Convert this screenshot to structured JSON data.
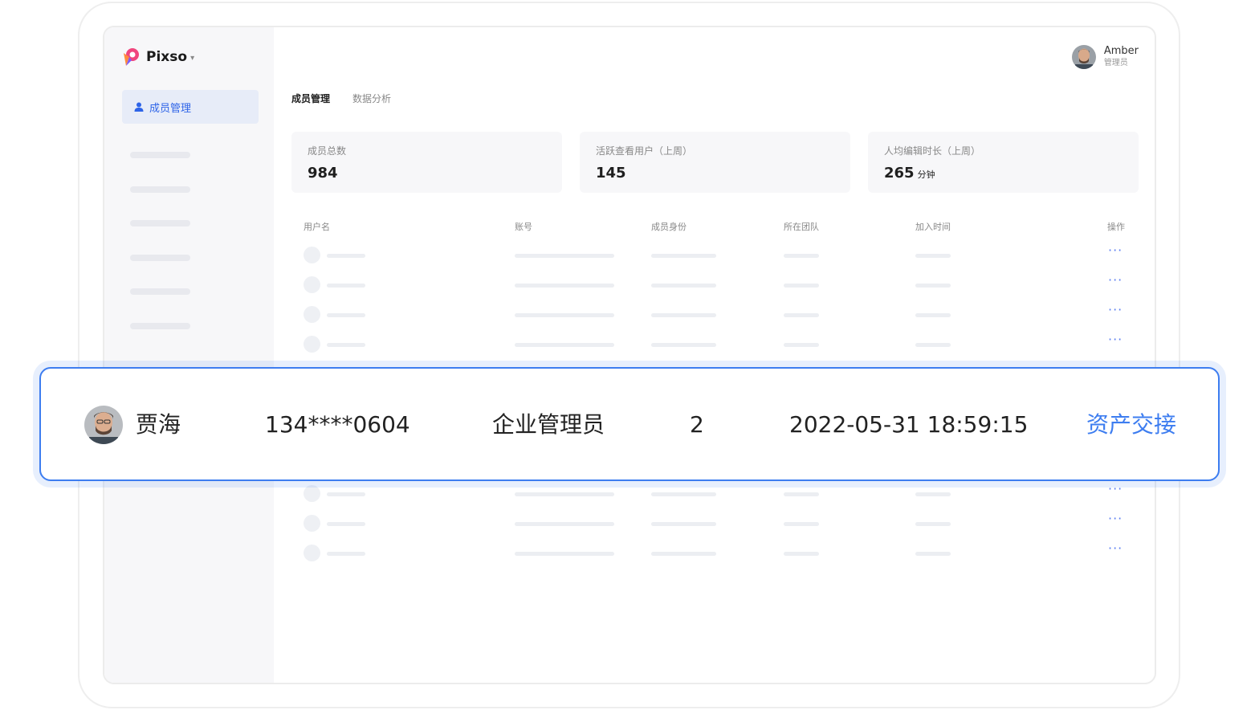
{
  "app": {
    "name": "Pixso"
  },
  "sidebar": {
    "items": [
      {
        "label": "成员管理"
      }
    ]
  },
  "user": {
    "name": "Amber",
    "role": "管理员"
  },
  "tabs": [
    {
      "label": "成员管理",
      "active": true
    },
    {
      "label": "数据分析",
      "active": false
    }
  ],
  "stats": [
    {
      "label": "成员总数",
      "value": "984",
      "unit": ""
    },
    {
      "label": "活跃查看用户（上周）",
      "value": "145",
      "unit": ""
    },
    {
      "label": "人均编辑时长（上周）",
      "value": "265",
      "unit": "分钟"
    }
  ],
  "table": {
    "headers": [
      "用户名",
      "账号",
      "成员身份",
      "所在团队",
      "加入时间",
      "操作"
    ],
    "row_action_icon": "more-dots-icon"
  },
  "highlight_row": {
    "name": "贾海",
    "account": "134****0604",
    "role": "企业管理员",
    "team_count": "2",
    "joined": "2022-05-31 18:59:15",
    "action": "资产交接"
  },
  "colors": {
    "accent": "#3d7df0",
    "sidebar_bg": "#f7f7f9",
    "brand_pink": "#f0457d"
  }
}
